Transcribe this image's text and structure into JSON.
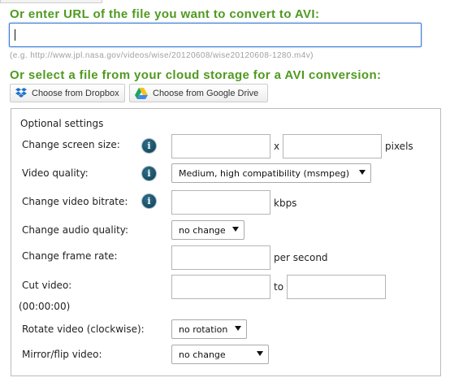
{
  "url_section": {
    "heading": "Or enter URL of the file you want to convert to AVI:",
    "input_value": "",
    "example": "(e.g. http://www.jpl.nasa.gov/videos/wise/20120608/wise20120608-1280.m4v)"
  },
  "cloud_section": {
    "heading": "Or select a file from your cloud storage for a AVI conversion:",
    "buttons": [
      {
        "label": "Choose from Dropbox",
        "icon": "dropbox-icon"
      },
      {
        "label": "Choose from Google Drive",
        "icon": "google-drive-icon"
      }
    ]
  },
  "optional_settings": {
    "title": "Optional settings",
    "info_glyph": "i",
    "screen_size": {
      "label": "Change screen size:",
      "separator": "x",
      "unit": "pixels",
      "width": "",
      "height": ""
    },
    "video_quality": {
      "label": "Video quality:",
      "selected": "Medium, high compatibility (msmpeg)"
    },
    "video_bitrate": {
      "label": "Change video bitrate:",
      "unit": "kbps",
      "value": ""
    },
    "audio_quality": {
      "label": "Change audio quality:",
      "selected": "no change"
    },
    "frame_rate": {
      "label": "Change frame rate:",
      "unit": "per second",
      "value": ""
    },
    "cut_video": {
      "label": "Cut video:",
      "format_hint": "(00:00:00)",
      "separator": "to",
      "from": "",
      "to": ""
    },
    "rotate": {
      "label": "Rotate video (clockwise):",
      "selected": "no rotation"
    },
    "mirror": {
      "label": "Mirror/flip video:",
      "selected": "no change"
    }
  }
}
